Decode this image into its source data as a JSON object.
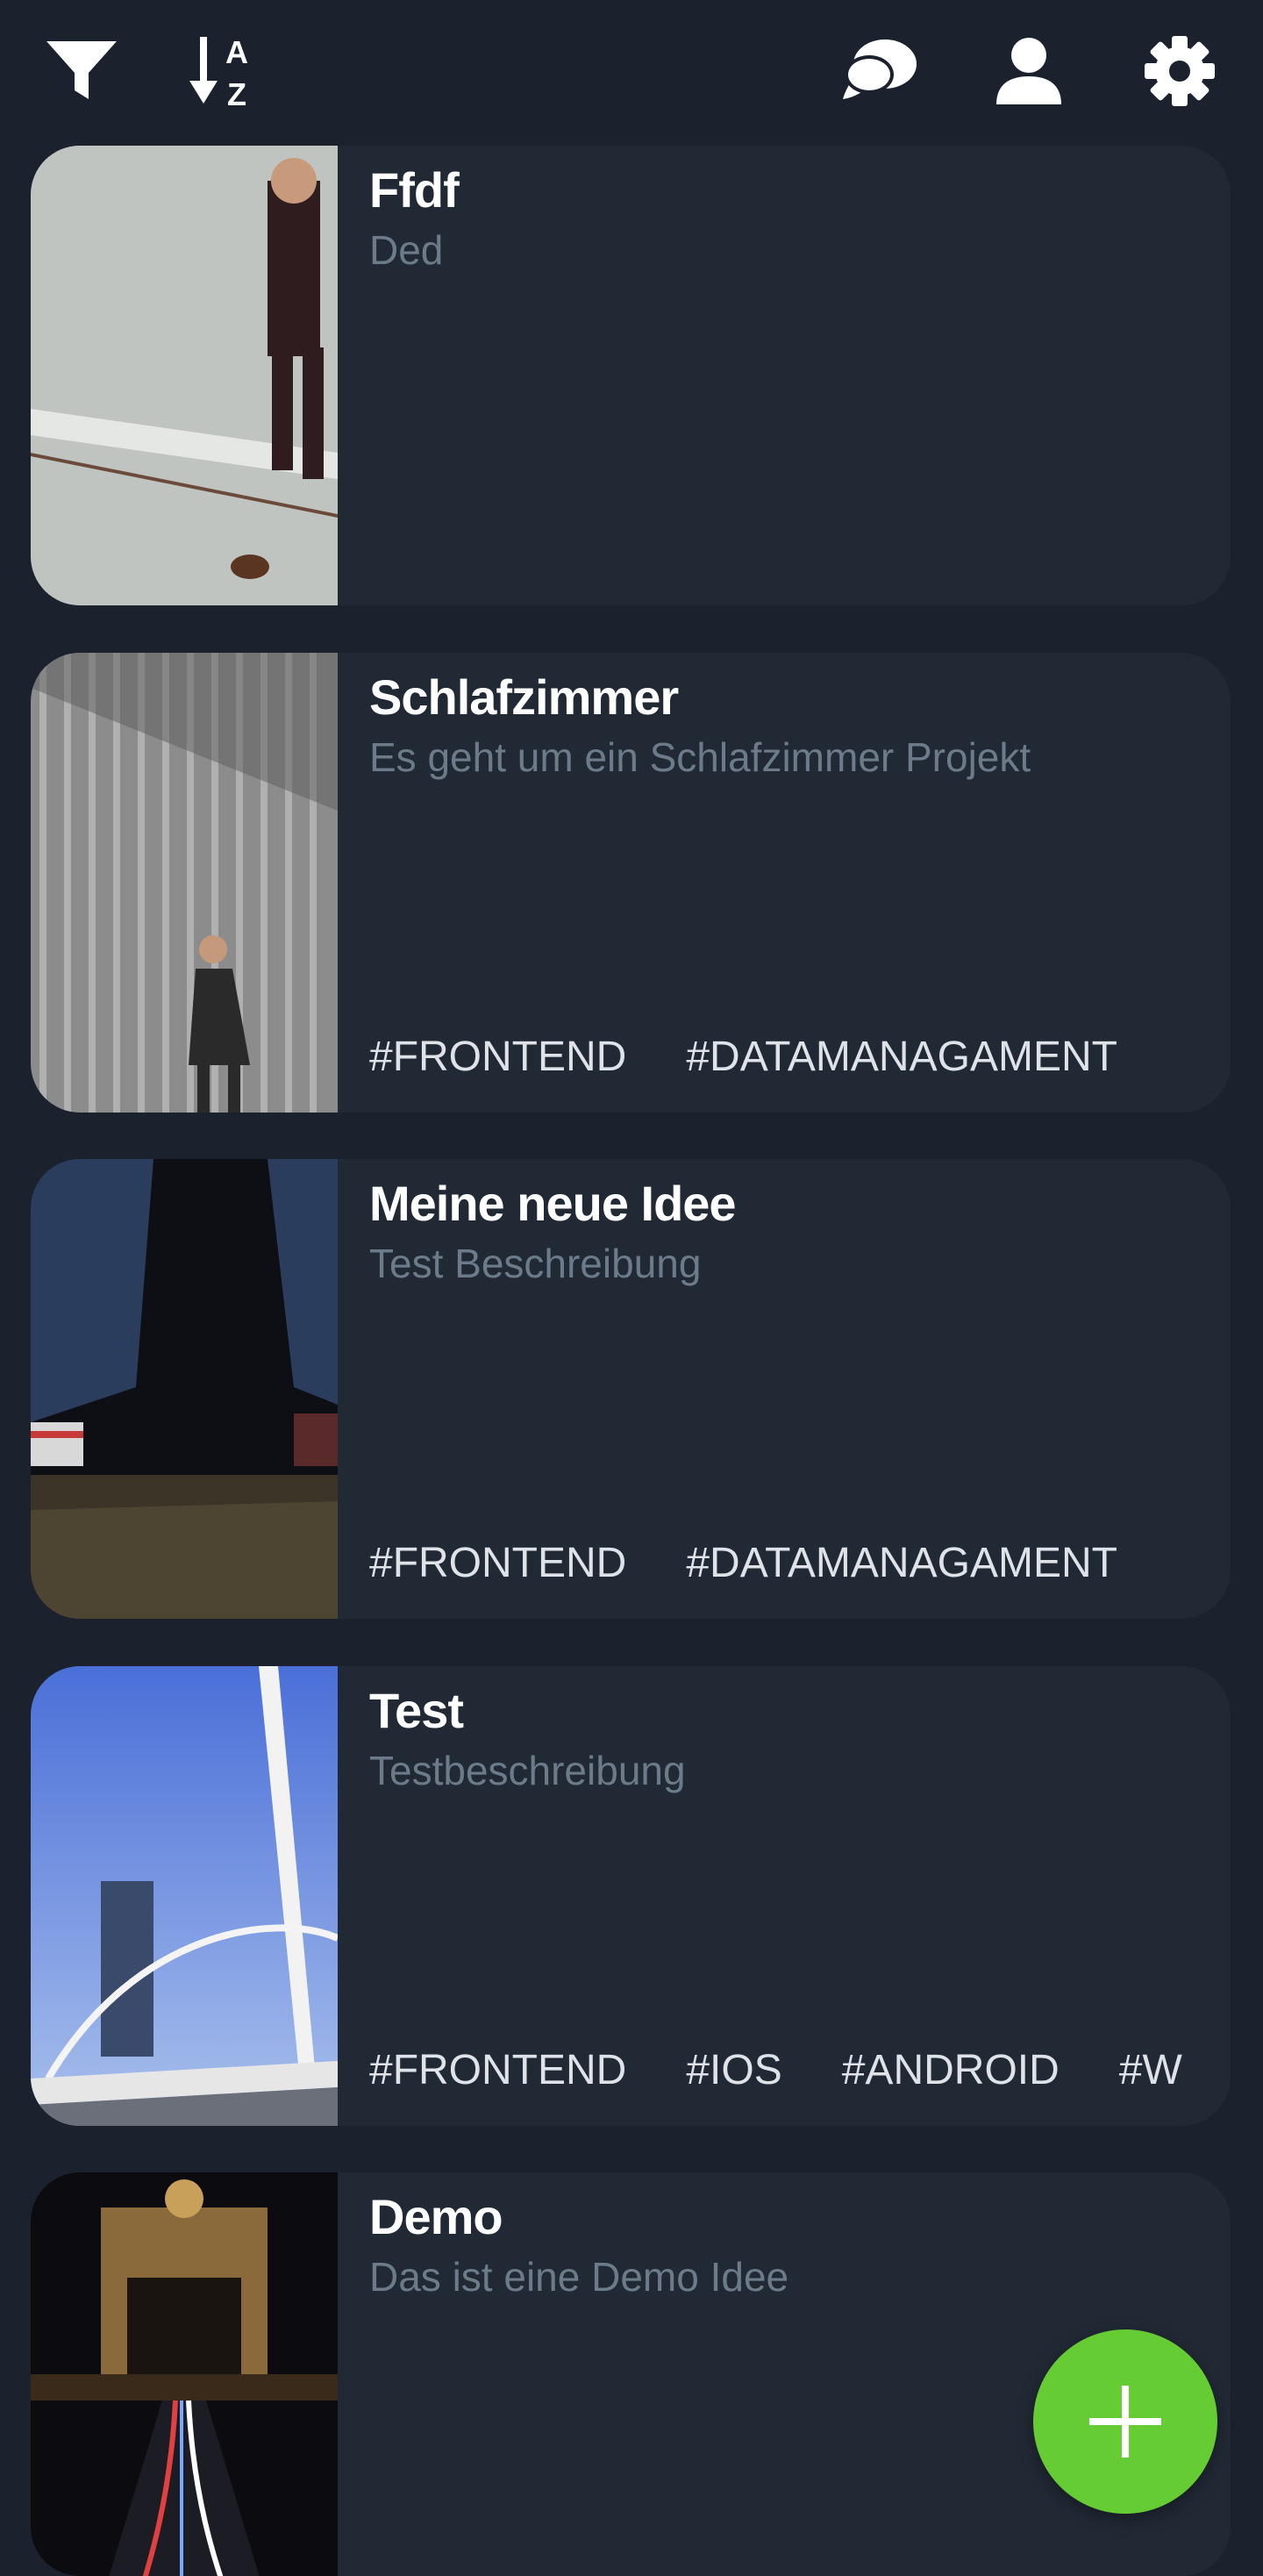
{
  "toolbar": {
    "filter_icon": "filter-icon",
    "sort_icon": "sort-alpha-icon",
    "sort_letters": [
      "A",
      "Z"
    ],
    "chat_icon": "chat-bubbles-icon",
    "profile_icon": "user-icon",
    "settings_icon": "gear-icon"
  },
  "cards": [
    {
      "title": "Ffdf",
      "description": "Ded",
      "tags": []
    },
    {
      "title": "Schlafzimmer",
      "description": "Es geht um ein Schlafzimmer Projekt",
      "tags": [
        "#FRONTEND",
        "#DATAMANAGAMENT"
      ]
    },
    {
      "title": "Meine neue Idee",
      "description": "Test Beschreibung",
      "tags": [
        "#FRONTEND",
        "#DATAMANAGAMENT"
      ]
    },
    {
      "title": "Test",
      "description": "Testbeschreibung",
      "tags": [
        "#FRONTEND",
        "#IOS",
        "#ANDROID",
        "#W"
      ]
    },
    {
      "title": "Demo",
      "description": "Das ist eine Demo Idee",
      "tags": []
    }
  ],
  "fab": {
    "icon": "plus-icon"
  },
  "colors": {
    "background": "#1b222d",
    "card": "#212935",
    "title": "#ffffff",
    "description": "#6c7b8a",
    "tag": "#dfe3e8",
    "fab": "#66cc33"
  }
}
